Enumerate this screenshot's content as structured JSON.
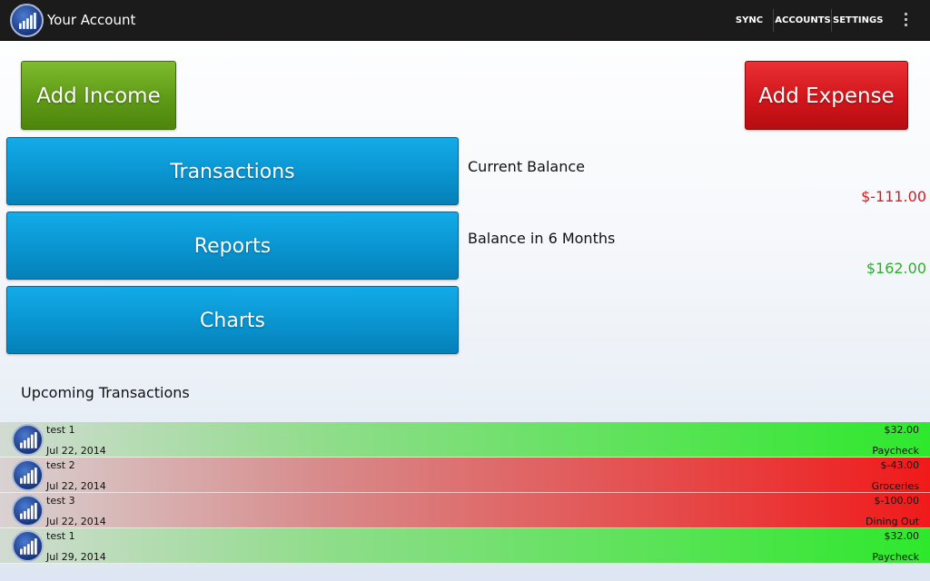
{
  "header": {
    "title": "Your Account",
    "actions": [
      {
        "label": "SYNC"
      },
      {
        "label": "ACCOUNTS"
      },
      {
        "label": "SETTINGS"
      }
    ],
    "overflow_icon": "more-vertical-icon",
    "app_icon": "bar-chart-icon"
  },
  "buttons": {
    "add_income": "Add Income",
    "add_expense": "Add Expense",
    "transactions": "Transactions",
    "reports": "Reports",
    "charts": "Charts"
  },
  "balances": {
    "current_label": "Current Balance",
    "current_value": "$-111.00",
    "future_label": "Balance in 6 Months",
    "future_value": "$162.00"
  },
  "upcoming": {
    "title": "Upcoming Transactions",
    "items": [
      {
        "name": "test 1",
        "date": "Jul 22, 2014",
        "amount": "$32.00",
        "category": "Paycheck",
        "kind": "income"
      },
      {
        "name": "test 2",
        "date": "Jul 22, 2014",
        "amount": "$-43.00",
        "category": "Groceries",
        "kind": "expense"
      },
      {
        "name": "test 3",
        "date": "Jul 22, 2014",
        "amount": "$-100.00",
        "category": "Dining Out",
        "kind": "expense"
      },
      {
        "name": "test 1",
        "date": "Jul 29, 2014",
        "amount": "$32.00",
        "category": "Paycheck",
        "kind": "income"
      }
    ]
  },
  "colors": {
    "negative": "#e0181e",
    "positive": "#2cb12a",
    "income_button": "#5f9a17",
    "expense_button": "#d2161b",
    "nav_button": "#0a94cf",
    "actionbar": "#1b1b1b"
  }
}
